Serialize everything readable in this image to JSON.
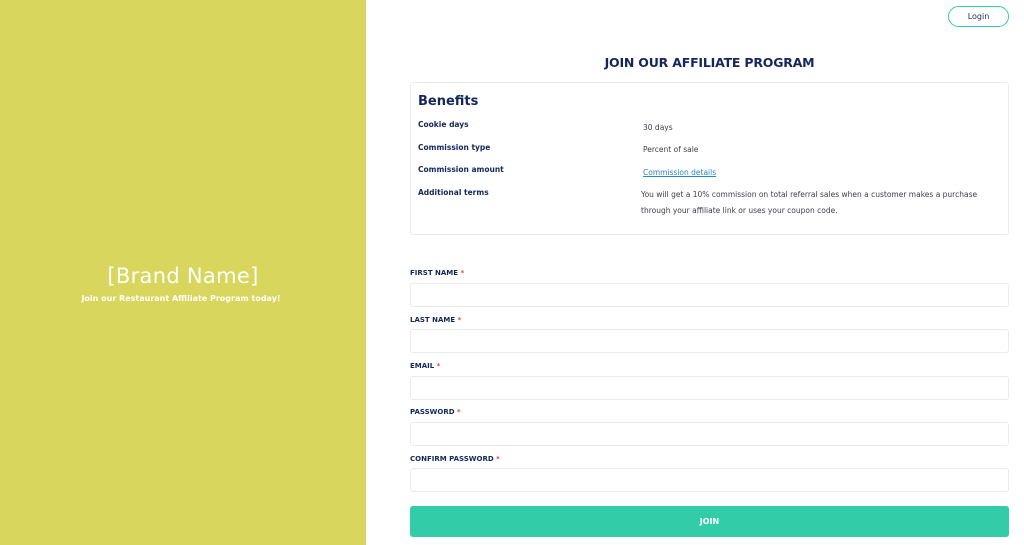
{
  "brand": {
    "name": "[Brand Name]",
    "tagline": "Join our Restaurant Affiliate Program today!"
  },
  "header": {
    "login_label": "Login"
  },
  "page": {
    "title": "JOIN OUR AFFILIATE PROGRAM"
  },
  "benefits": {
    "heading": "Benefits",
    "items": [
      {
        "label": "Cookie days",
        "value": "30 days"
      },
      {
        "label": "Commission type",
        "value": "Percent of sale"
      },
      {
        "label": "Commission amount",
        "value": "Commission details"
      },
      {
        "label": "Additional terms",
        "value": "You will get a 10% commission on total referral sales when a customer makes a purchase through your affiliate link or uses your coupon code."
      }
    ]
  },
  "form": {
    "required_marker": "*",
    "fields": [
      {
        "label": "FIRST NAME",
        "value": ""
      },
      {
        "label": "LAST NAME",
        "value": ""
      },
      {
        "label": "EMAIL",
        "value": ""
      },
      {
        "label": "PASSWORD",
        "value": ""
      },
      {
        "label": "CONFIRM PASSWORD",
        "value": ""
      }
    ],
    "submit_label": "JOIN"
  },
  "colors": {
    "brand_panel": "#d8d65c",
    "accent": "#33cca9",
    "heading": "#15275a",
    "link": "#2a86c7",
    "required": "#e0443b"
  }
}
